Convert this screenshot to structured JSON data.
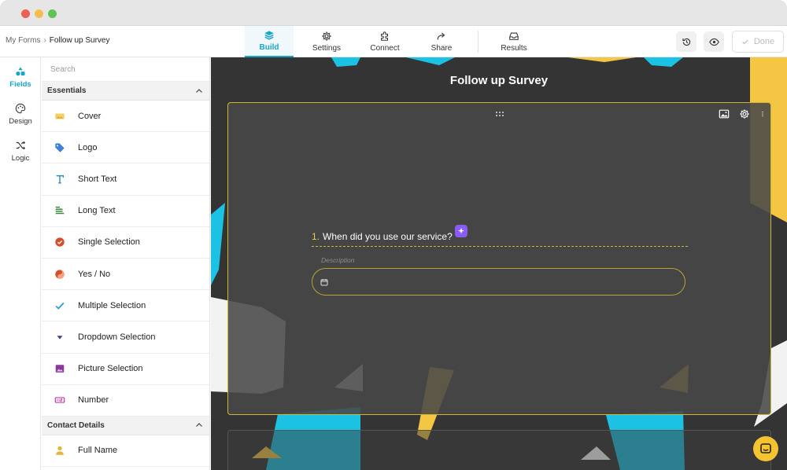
{
  "window": {
    "controls": [
      "close",
      "minimize",
      "maximize"
    ]
  },
  "breadcrumb": {
    "root": "My Forms",
    "separator": "›",
    "current": "Follow up Survey"
  },
  "nav": {
    "tabs": [
      {
        "label": "Build",
        "icon": "stack-icon",
        "active": true
      },
      {
        "label": "Settings",
        "icon": "gear-icon",
        "active": false
      },
      {
        "label": "Connect",
        "icon": "puzzle-icon",
        "active": false
      },
      {
        "label": "Share",
        "icon": "share-arrow-icon",
        "active": false
      },
      {
        "label": "Results",
        "icon": "inbox-icon",
        "active": false
      }
    ]
  },
  "toolbar": {
    "done_label": "Done",
    "history_icon": "history-icon",
    "preview_icon": "eye-icon"
  },
  "rail": {
    "items": [
      {
        "label": "Fields",
        "icon": "shapes-icon",
        "active": true
      },
      {
        "label": "Design",
        "icon": "palette-icon",
        "active": false
      },
      {
        "label": "Logic",
        "icon": "shuffle-icon",
        "active": false
      }
    ]
  },
  "panel": {
    "search_placeholder": "Search",
    "sections": [
      {
        "title": "Essentials",
        "items": [
          {
            "label": "Cover",
            "icon": "image-cover-icon",
            "color": "#e7b33a"
          },
          {
            "label": "Logo",
            "icon": "tag-icon",
            "color": "#3d7fd9"
          },
          {
            "label": "Short Text",
            "icon": "text-t-icon",
            "color": "#2a8fc1"
          },
          {
            "label": "Long Text",
            "icon": "paragraph-lines-icon",
            "color": "#3a8a3a"
          },
          {
            "label": "Single Selection",
            "icon": "check-circle-icon",
            "color": "#d0512a"
          },
          {
            "label": "Yes / No",
            "icon": "yes-no-icon",
            "color": "#d0512a"
          },
          {
            "label": "Multiple Selection",
            "icon": "checkmark-icon",
            "color": "#2a9bd0"
          },
          {
            "label": "Dropdown Selection",
            "icon": "dropdown-caret-icon",
            "color": "#3a3f9a"
          },
          {
            "label": "Picture Selection",
            "icon": "picture-icon",
            "color": "#8a3a9a"
          },
          {
            "label": "Number",
            "icon": "number-box-icon",
            "color": "#c43ea0"
          }
        ]
      },
      {
        "title": "Contact Details",
        "items": [
          {
            "label": "Full Name",
            "icon": "person-icon",
            "color": "#e7b33a"
          }
        ]
      }
    ]
  },
  "canvas": {
    "form_title": "Follow up Survey",
    "question": {
      "number": "1.",
      "text": "When did you use our service?"
    },
    "description_placeholder": "Description",
    "accent_color": "#cfb831",
    "background_color": "#343434"
  }
}
